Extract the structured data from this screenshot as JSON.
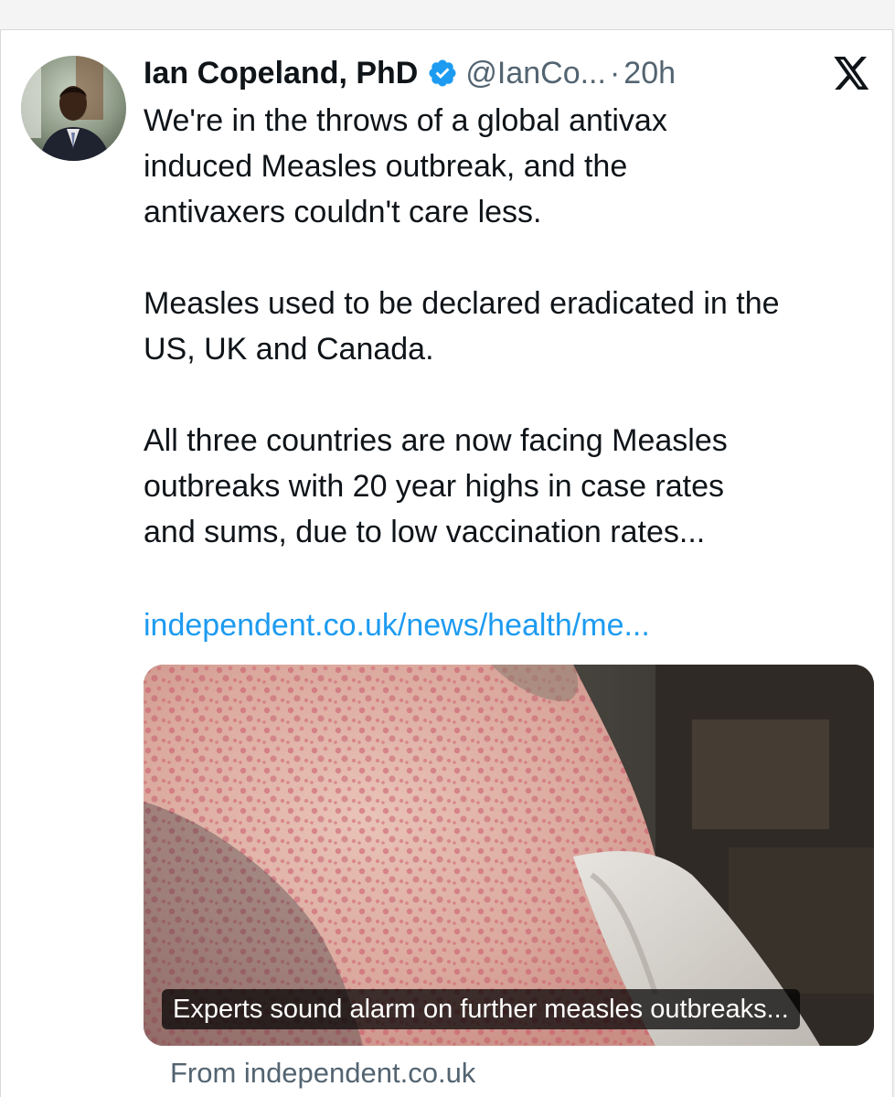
{
  "tweet": {
    "author_name": "Ian Copeland, PhD",
    "verified": true,
    "handle": "@IanCo...",
    "separator": "·",
    "time": "20h",
    "paragraphs": [
      "We're in the throws of a global antivax\ninduced Measles outbreak, and the\nantivaxers couldn't care less.",
      "Measles used to be declared eradicated in the\nUS, UK and Canada.",
      "All three countries are now facing Measles\noutbreaks with 20 year highs in case rates\nand sums, due to low vaccination rates..."
    ],
    "link_text": "independent.co.uk/news/health/me..."
  },
  "card": {
    "caption": "Experts sound alarm on further measles outbreaks...",
    "source": "From independent.co.uk"
  },
  "icons": {
    "verified": "verified-badge-icon",
    "platform": "x-logo-icon"
  },
  "colors": {
    "text": "#0f1419",
    "secondary": "#536471",
    "link": "#1d9bf0",
    "verified": "#1d9bf0"
  }
}
